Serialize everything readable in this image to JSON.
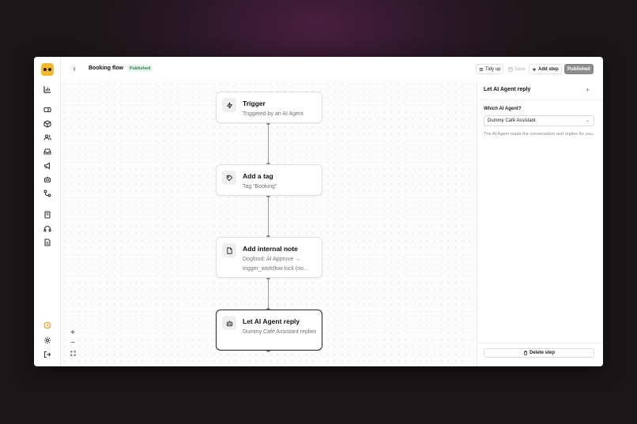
{
  "header": {
    "title": "Booking flow",
    "status_badge": "Published",
    "tidy_up": "Tidy up",
    "save": "Save",
    "add_step": "Add step",
    "published_button": "Published"
  },
  "sidebar": {
    "icons": [
      "analytics-icon",
      "ticket-icon",
      "box-icon",
      "users-icon",
      "inbox-icon",
      "megaphone-icon",
      "bot-icon",
      "workflow-icon",
      "book-icon",
      "headset-icon",
      "document-icon",
      "clock-icon",
      "settings-icon",
      "logout-icon"
    ],
    "active_color": "#f29d1f"
  },
  "canvas": {
    "nodes": [
      {
        "title": "Trigger",
        "subtitle": "Triggered by an AI Agent",
        "icon": "bolt-icon"
      },
      {
        "title": "Add a tag",
        "subtitle": "Tag “Booking”",
        "icon": "tag-icon"
      },
      {
        "title": "Add internal note",
        "subtitle": "Dogfood: AI Approve → trigger_workflow kick (no...",
        "icon": "note-icon"
      },
      {
        "title": "Let AI Agent reply",
        "subtitle": "Dummy Café Assistant replies",
        "icon": "bot-icon"
      }
    ],
    "zoom_in": "+",
    "zoom_out": "−"
  },
  "panel": {
    "title": "Let AI Agent reply",
    "field_label": "Which AI Agent?",
    "selected_agent": "Dummy Café Assistant",
    "help_text": "The AI Agent reads the conversation and replies for you.",
    "delete_label": "Delete step"
  },
  "colors": {
    "accent_badge": "#2e7d4a",
    "published_bg": "#8d8d8d"
  }
}
